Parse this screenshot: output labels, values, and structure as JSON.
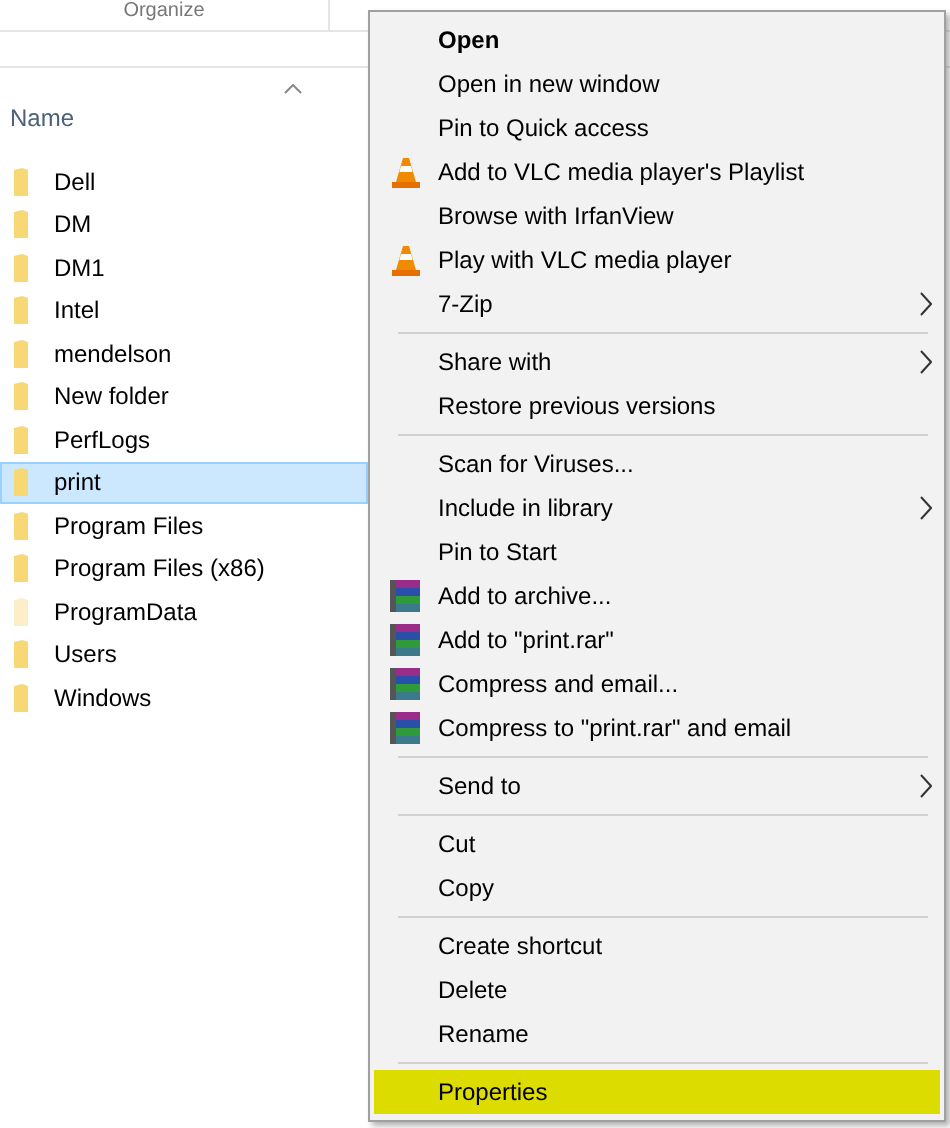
{
  "ribbon": [
    "Organize"
  ],
  "column_header": "Name",
  "folders": [
    {
      "name": "Dell",
      "selected": false,
      "hidden": false
    },
    {
      "name": "DM",
      "selected": false,
      "hidden": false
    },
    {
      "name": "DM1",
      "selected": false,
      "hidden": false
    },
    {
      "name": "Intel",
      "selected": false,
      "hidden": false
    },
    {
      "name": "mendelson",
      "selected": false,
      "hidden": false
    },
    {
      "name": "New folder",
      "selected": false,
      "hidden": false
    },
    {
      "name": "PerfLogs",
      "selected": false,
      "hidden": false
    },
    {
      "name": "print",
      "selected": true,
      "hidden": false
    },
    {
      "name": "Program Files",
      "selected": false,
      "hidden": false
    },
    {
      "name": "Program Files (x86)",
      "selected": false,
      "hidden": false
    },
    {
      "name": "ProgramData",
      "selected": false,
      "hidden": true
    },
    {
      "name": "Users",
      "selected": false,
      "hidden": false
    },
    {
      "name": "Windows",
      "selected": false,
      "hidden": false
    }
  ],
  "context_menu": [
    {
      "kind": "plain",
      "label": "Open",
      "default": true,
      "submenu": false,
      "highlighted": false
    },
    {
      "kind": "plain",
      "label": "Open in new window",
      "default": false,
      "submenu": false,
      "highlighted": false
    },
    {
      "kind": "plain",
      "label": "Pin to Quick access",
      "default": false,
      "submenu": false,
      "highlighted": false
    },
    {
      "kind": "vlc",
      "label": "Add to VLC media player's Playlist",
      "default": false,
      "submenu": false,
      "highlighted": false
    },
    {
      "kind": "plain",
      "label": "Browse with IrfanView",
      "default": false,
      "submenu": false,
      "highlighted": false
    },
    {
      "kind": "vlc",
      "label": "Play with VLC media player",
      "default": false,
      "submenu": false,
      "highlighted": false
    },
    {
      "kind": "plain",
      "label": "7-Zip",
      "default": false,
      "submenu": true,
      "highlighted": false
    },
    {
      "kind": "separator"
    },
    {
      "kind": "plain",
      "label": "Share with",
      "default": false,
      "submenu": true,
      "highlighted": false
    },
    {
      "kind": "plain",
      "label": "Restore previous versions",
      "default": false,
      "submenu": false,
      "highlighted": false
    },
    {
      "kind": "separator"
    },
    {
      "kind": "plain",
      "label": "Scan for Viruses...",
      "default": false,
      "submenu": false,
      "highlighted": false
    },
    {
      "kind": "plain",
      "label": "Include in library",
      "default": false,
      "submenu": true,
      "highlighted": false
    },
    {
      "kind": "plain",
      "label": "Pin to Start",
      "default": false,
      "submenu": false,
      "highlighted": false
    },
    {
      "kind": "archive",
      "label": "Add to archive...",
      "default": false,
      "submenu": false,
      "highlighted": false
    },
    {
      "kind": "archive",
      "label": "Add to \"print.rar\"",
      "default": false,
      "submenu": false,
      "highlighted": false
    },
    {
      "kind": "archive",
      "label": "Compress and email...",
      "default": false,
      "submenu": false,
      "highlighted": false
    },
    {
      "kind": "archive",
      "label": "Compress to \"print.rar\" and email",
      "default": false,
      "submenu": false,
      "highlighted": false
    },
    {
      "kind": "separator"
    },
    {
      "kind": "plain",
      "label": "Send to",
      "default": false,
      "submenu": true,
      "highlighted": false
    },
    {
      "kind": "separator"
    },
    {
      "kind": "plain",
      "label": "Cut",
      "default": false,
      "submenu": false,
      "highlighted": false
    },
    {
      "kind": "plain",
      "label": "Copy",
      "default": false,
      "submenu": false,
      "highlighted": false
    },
    {
      "kind": "separator"
    },
    {
      "kind": "plain",
      "label": "Create shortcut",
      "default": false,
      "submenu": false,
      "highlighted": false
    },
    {
      "kind": "plain",
      "label": "Delete",
      "default": false,
      "submenu": false,
      "highlighted": false
    },
    {
      "kind": "plain",
      "label": "Rename",
      "default": false,
      "submenu": false,
      "highlighted": false
    },
    {
      "kind": "separator"
    },
    {
      "kind": "plain",
      "label": "Properties",
      "default": false,
      "submenu": false,
      "highlighted": true
    }
  ]
}
